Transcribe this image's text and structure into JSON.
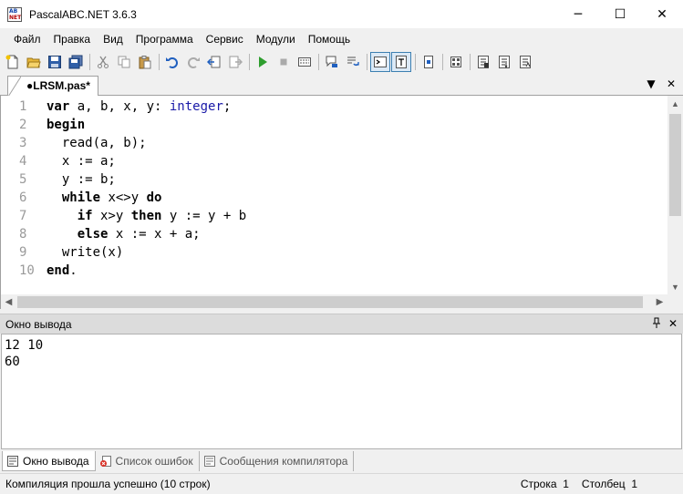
{
  "window": {
    "title": "PascalABC.NET 3.6.3",
    "icon_top": "AB",
    "icon_bottom": "NET",
    "minimize_glyph": "─",
    "maximize_glyph": "☐",
    "close_glyph": "✕"
  },
  "menu": {
    "items": [
      "Файл",
      "Правка",
      "Вид",
      "Программа",
      "Сервис",
      "Модули",
      "Помощь"
    ]
  },
  "toolbar": {
    "icons": [
      "new-file-icon",
      "open-folder-icon",
      "save-icon",
      "save-all-icon",
      "cut-icon",
      "copy-icon",
      "paste-icon",
      "undo-icon",
      "redo-icon",
      "navigate-back-icon",
      "navigate-forward-icon",
      "run-icon",
      "stop-icon",
      "compile-icon",
      "debug-step-icon",
      "step-over-icon",
      "console-output-icon",
      "text-output-icon",
      "page-icon",
      "split-icon",
      "debug-1-icon",
      "debug-2-icon",
      "debug-3-icon"
    ],
    "colors": {
      "run": "#2e9e2e",
      "undo": "#1f5fbf",
      "folder": "#e8b83a"
    }
  },
  "editor_tab": {
    "label": "●LRSM.pas*",
    "dropdown_glyph": "▼",
    "close_glyph": "✕"
  },
  "editor": {
    "line_numbers": [
      "1",
      "2",
      "3",
      "4",
      "5",
      "6",
      "7",
      "8",
      "9",
      "10"
    ],
    "lines": [
      [
        {
          "t": "var",
          "k": "kw"
        },
        {
          "t": " a, b, x, y: ",
          "k": ""
        },
        {
          "t": "integer",
          "k": "ty"
        },
        {
          "t": ";",
          "k": ""
        }
      ],
      [
        {
          "t": "begin",
          "k": "kw"
        }
      ],
      [
        {
          "t": "  read(a, b);",
          "k": ""
        }
      ],
      [
        {
          "t": "  x := a;",
          "k": ""
        }
      ],
      [
        {
          "t": "  y := b;",
          "k": ""
        }
      ],
      [
        {
          "t": "  ",
          "k": ""
        },
        {
          "t": "while",
          "k": "kw"
        },
        {
          "t": " x<>y ",
          "k": ""
        },
        {
          "t": "do",
          "k": "kw"
        }
      ],
      [
        {
          "t": "    ",
          "k": ""
        },
        {
          "t": "if",
          "k": "kw"
        },
        {
          "t": " x>y ",
          "k": ""
        },
        {
          "t": "then",
          "k": "kw"
        },
        {
          "t": " y := y + b",
          "k": ""
        }
      ],
      [
        {
          "t": "    ",
          "k": ""
        },
        {
          "t": "else",
          "k": "kw"
        },
        {
          "t": " x := x + a;",
          "k": ""
        }
      ],
      [
        {
          "t": "  write(x)",
          "k": ""
        }
      ],
      [
        {
          "t": "end",
          "k": "kw"
        },
        {
          "t": ".",
          "k": ""
        }
      ]
    ],
    "keyword_color": "#000000",
    "type_color": "#1a1aa8"
  },
  "output": {
    "title": "Окно вывода",
    "pin_glyph": "ᅟ",
    "close_glyph": "✕",
    "lines": [
      "12 10",
      "60"
    ]
  },
  "bottom_tabs": [
    {
      "label": "Окно вывода",
      "active": true
    },
    {
      "label": "Список ошибок",
      "active": false
    },
    {
      "label": "Сообщения компилятора",
      "active": false
    }
  ],
  "status": {
    "message": "Компиляция прошла успешно (10 строк)",
    "row_label": "Строка",
    "row_value": "1",
    "col_label": "Столбец",
    "col_value": "1"
  }
}
